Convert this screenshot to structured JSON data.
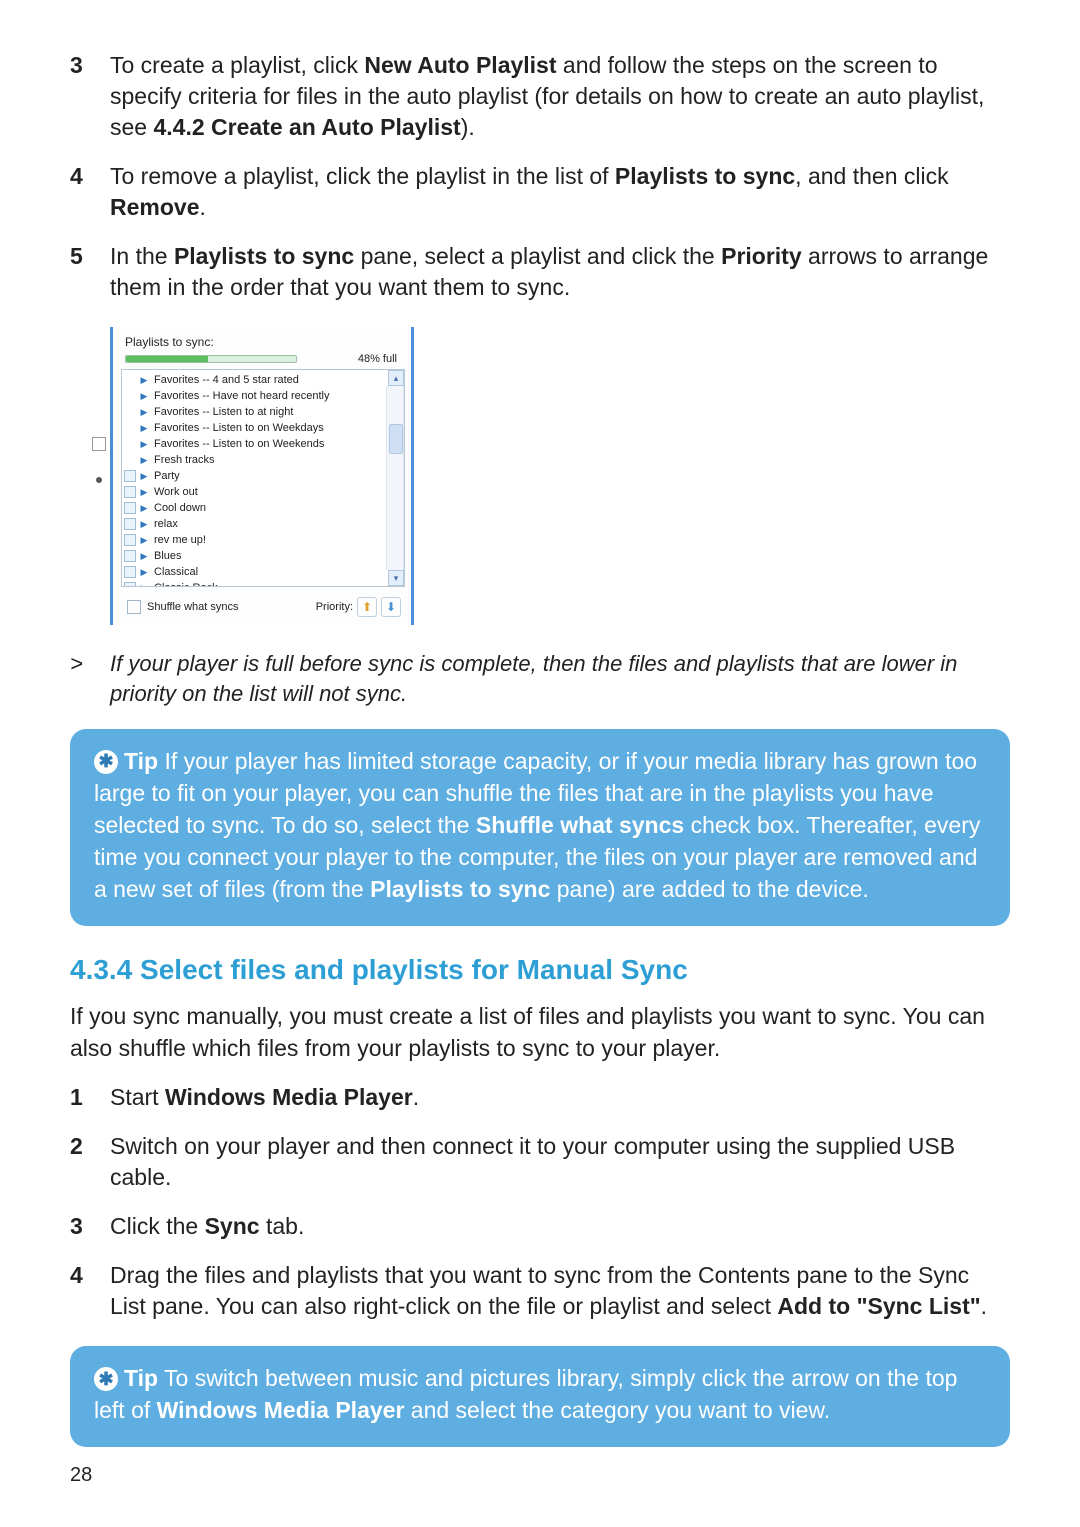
{
  "steps_a": [
    {
      "num": "3",
      "pre": "To create a playlist, click ",
      "b1": "New Auto Playlist",
      "mid": " and follow the steps on the screen to specify criteria for files in the auto playlist (for details on how to create an auto playlist, see ",
      "b2": "4.4.2 Create an Auto Playlist",
      "post": ")."
    },
    {
      "num": "4",
      "pre": "To remove a playlist, click the playlist in the list of ",
      "b1": "Playlists to sync",
      "mid": ", and then click ",
      "b2": "Remove",
      "post": "."
    },
    {
      "num": "5",
      "pre": "In the ",
      "b1": "Playlists to sync",
      "mid": " pane, select a playlist and click the ",
      "b2": "Priority",
      "post": " arrows to arrange them in the order that you want them to sync."
    }
  ],
  "screenshot": {
    "title": "Playlists to sync:",
    "percent": "48% full",
    "shuffle_label": "Shuffle what syncs",
    "priority_label": "Priority:",
    "items": [
      {
        "sq": false,
        "label": "Favorites -- 4 and 5 star rated"
      },
      {
        "sq": false,
        "label": "Favorites -- Have not heard recently"
      },
      {
        "sq": false,
        "label": "Favorites -- Listen to at night"
      },
      {
        "sq": false,
        "label": "Favorites -- Listen to on Weekdays"
      },
      {
        "sq": false,
        "label": "Favorites -- Listen to on Weekends"
      },
      {
        "sq": false,
        "label": "Fresh tracks"
      },
      {
        "sq": true,
        "label": "Party"
      },
      {
        "sq": true,
        "label": "Work out"
      },
      {
        "sq": true,
        "label": "Cool down"
      },
      {
        "sq": true,
        "label": "relax"
      },
      {
        "sq": true,
        "label": "rev me up!"
      },
      {
        "sq": true,
        "label": "Blues"
      },
      {
        "sq": true,
        "label": "Classical"
      },
      {
        "sq": true,
        "label": "Classic Rock"
      }
    ]
  },
  "note": {
    "gt": ">",
    "text": "If your player is full before sync is complete, then the files and playlists that are lower in priority on the list will not sync."
  },
  "tip1": {
    "label": "Tip",
    "t1": " If your player has limited storage capacity, or if your media library has grown too large to fit on your player, you can shuffle the files that are in the playlists you have selected to sync. To do so, select the ",
    "b1": "Shuffle what syncs",
    "t2": " check box. Thereafter, every time you connect your player to the computer, the files on your player are removed and a new set of files (from the ",
    "b2": "Playlists to sync",
    "t3": " pane) are added to the device."
  },
  "heading_434": "4.3.4 Select files and playlists for Manual Sync",
  "intro_434": "If you sync manually, you must create a list of files and playlists you want to sync. You can also shuffle which files from your playlists to sync to your player.",
  "steps_b": [
    {
      "pre": "Start ",
      "b1": "Windows Media Player",
      "post": "."
    },
    {
      "pre": "Switch on your player and then connect it to your computer using the supplied USB cable.",
      "b1": "",
      "post": ""
    },
    {
      "pre": "Click the ",
      "b1": "Sync",
      "post": " tab."
    },
    {
      "pre": "Drag the files and playlists that you want to sync from the Contents pane to the Sync List pane. You can also right-click on the file or playlist and select ",
      "b1": "Add to \"Sync List\"",
      "post": "."
    }
  ],
  "tip2": {
    "label": "Tip",
    "t1": " To switch between music and pictures library, simply click the arrow on the top left of ",
    "b1": "Windows Media Player",
    "t2": " and select the category you want to view."
  },
  "page_number": "28"
}
